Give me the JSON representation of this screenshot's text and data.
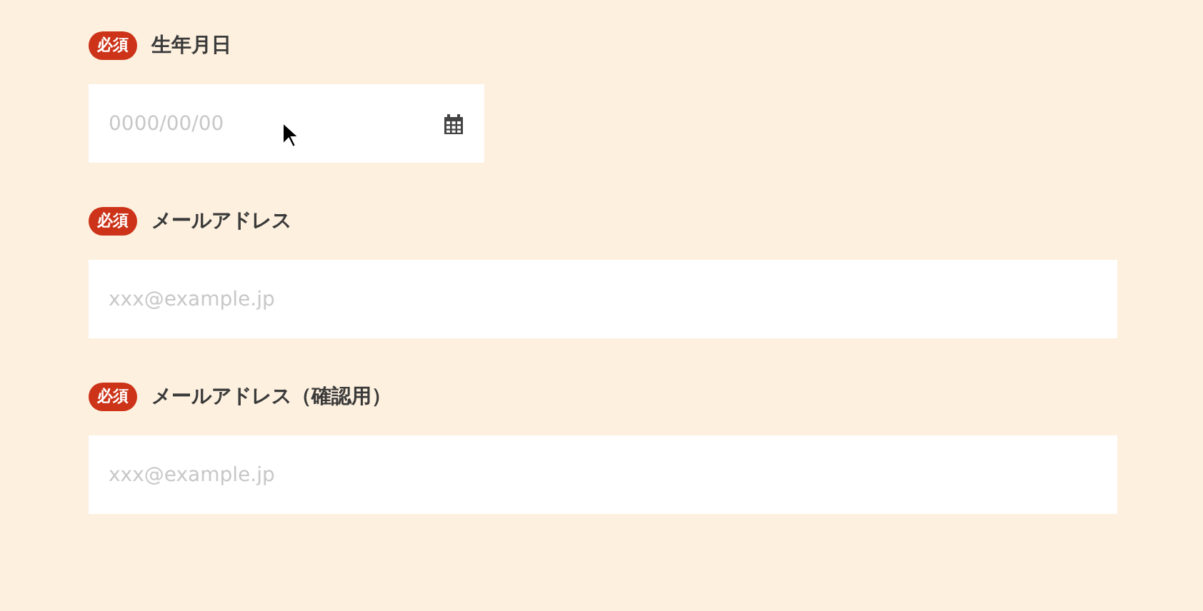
{
  "fields": [
    {
      "label": "生年月日",
      "required": true,
      "badge": "必須",
      "kind": "date",
      "placeholder": "0000/00/00"
    },
    {
      "label": "メールアドレス",
      "required": true,
      "badge": "必須",
      "kind": "email",
      "placeholder": "xxx@example.jp"
    },
    {
      "label": "メールアドレス（確認用）",
      "required": true,
      "badge": "必須",
      "kind": "email",
      "placeholder": "xxx@example.jp"
    }
  ]
}
